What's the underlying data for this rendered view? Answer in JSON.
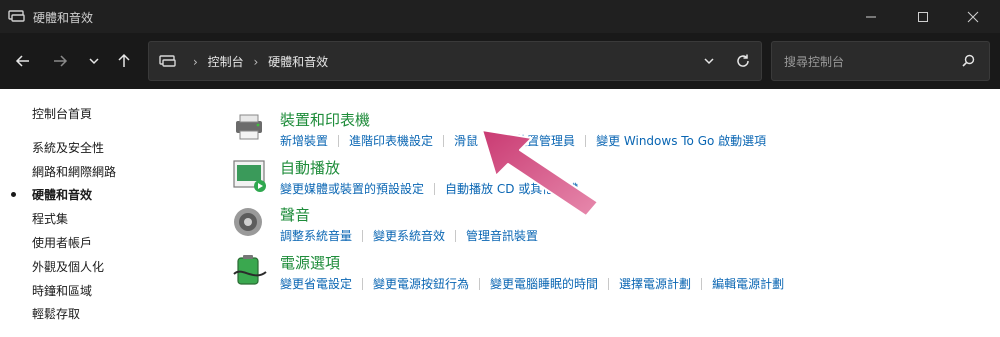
{
  "window": {
    "title": "硬體和音效"
  },
  "address": {
    "crumbs": [
      "控制台",
      "硬體和音效"
    ]
  },
  "search": {
    "placeholder": "搜尋控制台"
  },
  "sidebar": {
    "items": [
      {
        "label": "控制台首頁",
        "current": false
      },
      {
        "label": "系統及安全性",
        "current": false
      },
      {
        "label": "網路和網際網路",
        "current": false
      },
      {
        "label": "硬體和音效",
        "current": true
      },
      {
        "label": "程式集",
        "current": false
      },
      {
        "label": "使用者帳戶",
        "current": false
      },
      {
        "label": "外觀及個人化",
        "current": false
      },
      {
        "label": "時鐘和區域",
        "current": false
      },
      {
        "label": "輕鬆存取",
        "current": false
      }
    ]
  },
  "categories": [
    {
      "title": "裝置和印表機",
      "icon": "devices-printers-icon",
      "links": [
        "新增裝置",
        "進階印表機設定",
        "滑鼠",
        "裝置管理員",
        "變更 Windows To Go 啟動選項"
      ]
    },
    {
      "title": "自動播放",
      "icon": "autoplay-icon",
      "links": [
        "變更媒體或裝置的預設設定",
        "自動播放 CD 或其他媒體"
      ]
    },
    {
      "title": "聲音",
      "icon": "speaker-icon",
      "links": [
        "調整系統音量",
        "變更系統音效",
        "管理音訊裝置"
      ]
    },
    {
      "title": "電源選項",
      "icon": "battery-icon",
      "links": [
        "變更省電設定",
        "變更電源按鈕行為",
        "變更電腦睡眠的時間",
        "選擇電源計劃",
        "編輯電源計劃"
      ]
    }
  ],
  "colors": {
    "category_title": "#1e8c3a",
    "link": "#0a66b3",
    "titlebar": "#202020",
    "toolbar": "#191919",
    "annotation_arrow": "#d6457f"
  }
}
